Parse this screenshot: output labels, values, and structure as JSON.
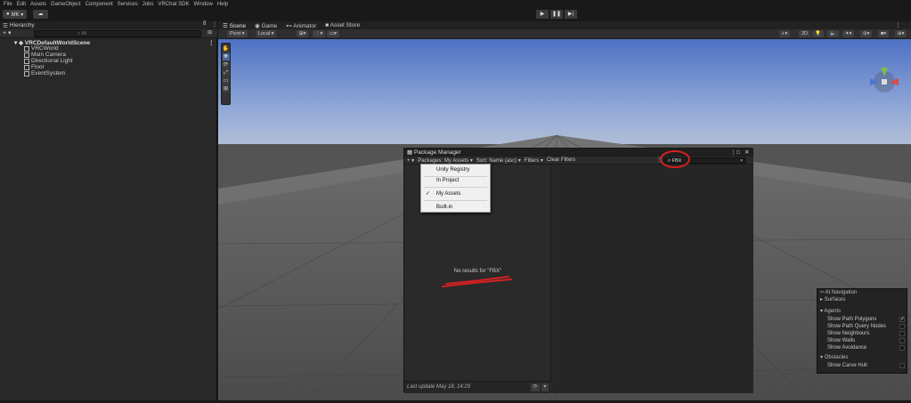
{
  "menu": [
    "File",
    "Edit",
    "Assets",
    "GameObject",
    "Component",
    "Services",
    "Jobs",
    "VRChat SDK",
    "Window",
    "Help"
  ],
  "account": {
    "label": "MK ▾",
    "cloud_icon": "cloud-icon"
  },
  "play_controls": [
    "▶",
    "❚❚",
    "▶|"
  ],
  "hierarchy": {
    "tab_label": "Hierarchy",
    "add_label": "+ ▾",
    "search_placeholder": "All",
    "scene_name": "VRCDefaultWorldScene",
    "items": [
      "VRCWorld",
      "Main Camera",
      "Directional Light",
      "Floor",
      "EventSystem"
    ]
  },
  "scene_tabs": [
    "Scene",
    "Game",
    "Animator",
    "Asset Store"
  ],
  "scene_toolbar": {
    "pivot": "Pivot ▾",
    "local": "Local ▾",
    "mode_2d": "2D"
  },
  "tools": [
    "✋",
    "✥",
    "⟳",
    "⤢",
    "▭",
    "⊞"
  ],
  "package_manager": {
    "title": "Package Manager",
    "add_label": "+ ▾",
    "packages_filter": "Packages: My Assets ▾",
    "sort": "Sort: Name (asc) ▾",
    "filters": "Filters ▾",
    "clear_filters": "Clear Filters",
    "search_value": "FBX",
    "empty_message": "No results for \"FBX\"",
    "last_update": "Last update May 18, 14:29"
  },
  "dropdown": {
    "items": [
      "Unity Registry",
      "In Project",
      "My Assets",
      "Built-in"
    ],
    "selected": "My Assets",
    "check": "✓"
  },
  "ai_navigation": {
    "title": "AI Navigation",
    "surfaces": "Surfaces",
    "agents": "Agents",
    "agent_options": [
      "Show Path Polygons",
      "Show Path Query Nodes",
      "Show Neighbours",
      "Show Walls",
      "Show Avoidance"
    ],
    "agent_checked": [
      true,
      false,
      false,
      false,
      false
    ],
    "obstacles": "Obstacles",
    "obstacle_options": [
      "Show Carve Hull"
    ],
    "check": "✓"
  },
  "colors": {
    "annotation_red": "#d42020",
    "sky_top": "#5277c9",
    "floor": "#5f5f5f"
  }
}
